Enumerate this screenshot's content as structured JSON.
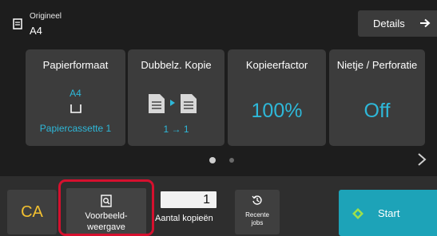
{
  "header": {
    "original_label": "Origineel",
    "original_value": "A4",
    "details_label": "Details"
  },
  "tiles": [
    {
      "title": "Papierformaat",
      "value": "A4",
      "sub": "Papiercassette 1"
    },
    {
      "title": "Dubbelz. Kopie",
      "sub": "1 → 1"
    },
    {
      "title": "Kopieerfactor",
      "value": "100%"
    },
    {
      "title": "Nietje / Perforatie",
      "value": "Off"
    }
  ],
  "pager": {
    "current_page": 1,
    "total_pages": 2
  },
  "bottom": {
    "ca_label": "CA",
    "preview_label_line1": "Voorbeeld-",
    "preview_label_line2": "weergave",
    "copies_value": "1",
    "copies_label": "Aantal kopieën",
    "recent_label_line1": "Recente",
    "recent_label_line2": "jobs",
    "start_label": "Start"
  },
  "colors": {
    "accent_blue": "#2eb8d9",
    "start_teal": "#1da3b8",
    "ca_yellow": "#f2c030",
    "highlight_red": "#d6102e"
  }
}
